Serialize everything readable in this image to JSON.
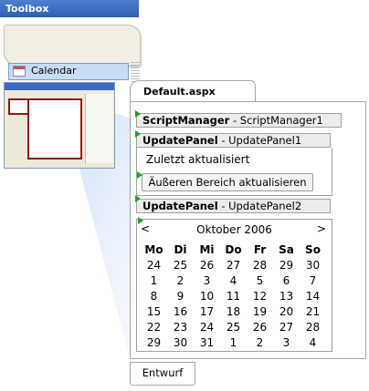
{
  "toolbox": {
    "title": "Toolbox",
    "item_label": "Calendar"
  },
  "document": {
    "tab_label": "Default.aspx",
    "script_manager": {
      "type": "ScriptManager",
      "id": "ScriptManager1"
    },
    "update_panel_1": {
      "type": "UpdatePanel",
      "id": "UpdatePanel1",
      "text": "Zuletzt aktualisiert",
      "button_label": "Äußeren Bereich aktualisieren"
    },
    "update_panel_2": {
      "type": "UpdatePanel",
      "id": "UpdatePanel2"
    },
    "calendar": {
      "prev": "<",
      "next": ">",
      "title": "Oktober 2006",
      "weekdays": [
        "Mo",
        "Di",
        "Mi",
        "Do",
        "Fr",
        "Sa",
        "So"
      ],
      "weeks": [
        [
          "24",
          "25",
          "26",
          "27",
          "28",
          "29",
          "30"
        ],
        [
          "1",
          "2",
          "3",
          "4",
          "5",
          "6",
          "7"
        ],
        [
          "8",
          "9",
          "10",
          "11",
          "12",
          "13",
          "14"
        ],
        [
          "15",
          "16",
          "17",
          "18",
          "19",
          "20",
          "21"
        ],
        [
          "22",
          "23",
          "24",
          "25",
          "26",
          "27",
          "28"
        ],
        [
          "29",
          "30",
          "31",
          "1",
          "2",
          "3",
          "4"
        ]
      ]
    },
    "design_tab_label": "Entwurf"
  },
  "colors": {
    "toolbox_header": "#2f5fb0",
    "control_border": "#8b1b1b",
    "smart_tag": "#22a022"
  }
}
